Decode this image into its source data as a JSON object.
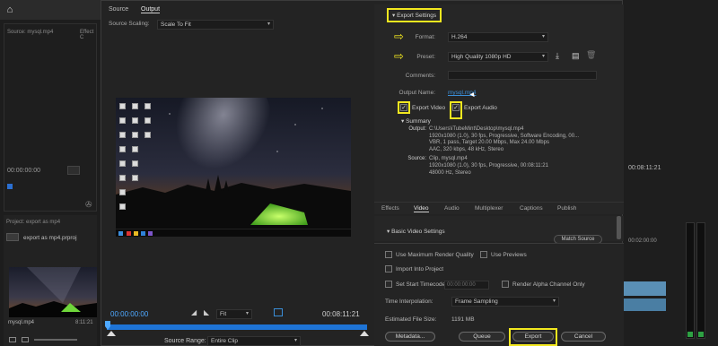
{
  "background": {
    "left_timecode": "00:00:00:00",
    "right_timecode": "00:08:11:21",
    "project_label": "Project: export as mp4",
    "project_file": "export as mp4.prproj",
    "source_label": "Source: mysql.mp4",
    "clip_name": "mysql.mp4",
    "clip_duration": "8:11:21",
    "effect_label": "Effect C",
    "right_timecode2": "00:02:00:00"
  },
  "source_panel": {
    "tabs": [
      "Source",
      "Output"
    ],
    "active_tab": "Output",
    "scaling_label": "Source Scaling:",
    "scaling_value": "Scale To Fit"
  },
  "player": {
    "current_time": "00:00:00:00",
    "duration": "00:08:11:21",
    "fit_value": "Fit",
    "source_range_label": "Source Range:",
    "source_range_value": "Entire Clip"
  },
  "export_settings": {
    "header": "Export Settings",
    "format_label": "Format:",
    "format_value": "H.264",
    "preset_label": "Preset:",
    "preset_value": "High Quality 1080p HD",
    "comments_label": "Comments:",
    "output_name_label": "Output Name:",
    "output_name_value": "mysql.mp4",
    "export_video_label": "Export Video",
    "export_audio_label": "Export Audio",
    "export_video_checked": true,
    "export_audio_checked": true,
    "summary_label": "Summary",
    "summary_output_label": "Output:",
    "summary_output_lines": [
      "C:\\Users\\iTubeMint\\Desktop\\mysql.mp4",
      "1920x1080 (1.0), 30 fps, Progressive, Software Encoding, 00...",
      "VBR, 1 pass, Target 20.00 Mbps, Max 24.00 Mbps",
      "AAC, 320 kbps, 48 kHz, Stereo"
    ],
    "summary_source_label": "Source:",
    "summary_source_lines": [
      "Clip, mysql.mp4",
      "1920x1080 (1.0), 30 fps, Progressive, 00:08:11:21",
      "48000 Hz, Stereo"
    ]
  },
  "lower_tabs": {
    "tabs": [
      "Effects",
      "Video",
      "Audio",
      "Multiplexer",
      "Captions",
      "Publish"
    ],
    "active_tab": "Video",
    "basic_video_settings": "Basic Video Settings",
    "match_source": "Match Source"
  },
  "bottom_options": {
    "max_render_quality": "Use Maximum Render Quality",
    "use_previews": "Use Previews",
    "import_into_project": "Import Into Project",
    "set_start_timecode": "Set Start Timecode",
    "timecode_value": "00:00:00:00",
    "render_alpha": "Render Alpha Channel Only",
    "time_interpolation_label": "Time Interpolation:",
    "time_interpolation_value": "Frame Sampling",
    "file_size_label": "Estimated File Size:",
    "file_size_value": "1191 MB",
    "metadata_button": "Metadata...",
    "queue_button": "Queue",
    "export_button": "Export",
    "cancel_button": "Cancel"
  },
  "colors": {
    "highlight": "#f2e71f",
    "accent_blue": "#1e74d6",
    "link_blue": "#3a8ed8"
  }
}
